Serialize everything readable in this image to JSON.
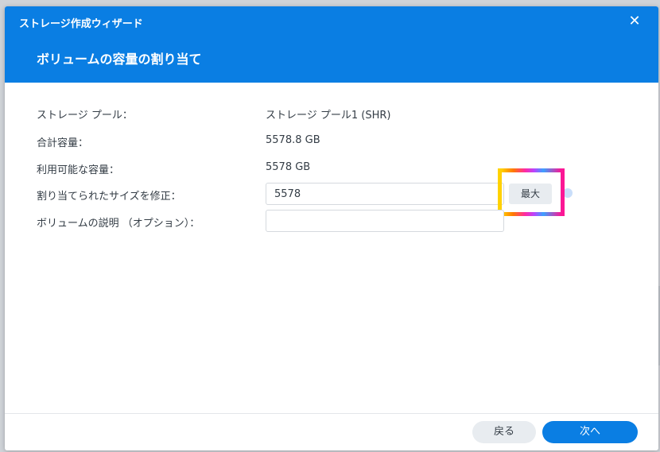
{
  "window": {
    "title": "ストレージ作成ウィザード",
    "close_glyph": "✕"
  },
  "step": {
    "title": "ボリュームの容量の割り当て"
  },
  "form": {
    "pool_label": "ストレージ プール：",
    "pool_value": "ストレージ プール1 (SHR)",
    "total_label": "合計容量：",
    "total_value": "5578.8 GB",
    "available_label": "利用可能な容量：",
    "available_value": "5578 GB",
    "size_label": "割り当てられたサイズを修正：",
    "size_value": "5578",
    "max_button": "最大",
    "desc_label": "ボリュームの説明 （オプション）：",
    "desc_value": ""
  },
  "footer": {
    "back_label": "戻る",
    "next_label": "次へ"
  },
  "colors": {
    "accent": "#0a7ee3",
    "highlight": "#ee1f9f"
  },
  "icons": {
    "close": "close-icon",
    "info": "info-icon"
  }
}
